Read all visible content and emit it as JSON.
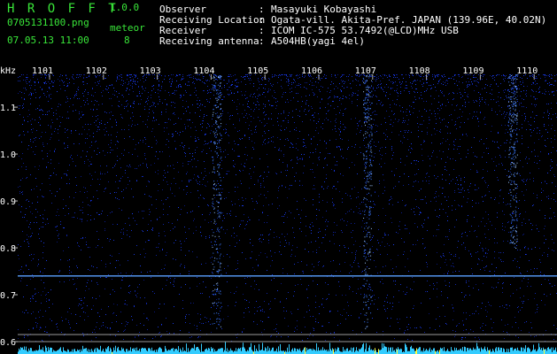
{
  "app": {
    "title": "H R O F F T",
    "version": "1.0.0",
    "filename": "0705131100.png",
    "datetime": "07.05.13 11:00",
    "meteor_label": "meteor",
    "meteor_count": "8"
  },
  "info": [
    {
      "label": "Observer",
      "sep": ":",
      "value": "Masayuki Kobayashi"
    },
    {
      "label": "Receiving Location",
      "sep": ":",
      "value": "Ogata-vill. Akita-Pref. JAPAN (139.96E, 40.02N)"
    },
    {
      "label": "Receiver",
      "sep": ":",
      "value": "ICOM IC-575 53.7492(@LCD)MHz USB"
    },
    {
      "label": "Receiving antenna",
      "sep": ":",
      "value": "A504HB(yagi 4el)"
    }
  ],
  "colors": {
    "title": "#39e639",
    "tick_text": "#ffffff",
    "background": "#000000",
    "noise": "#1a3cff",
    "carrier": "#5aa0ff",
    "histogram": "#33ccff",
    "histogram_hot": "#ffff40"
  },
  "chart_data": {
    "type": "heatmap",
    "ylabel": "kHz",
    "x_ticks": [
      "1101",
      "1102",
      "1103",
      "1104",
      "1105",
      "1106",
      "1107",
      "1108",
      "1109",
      "1110"
    ],
    "y_ticks": [
      "1.1",
      "1.0",
      "0.9",
      "0.8",
      "0.7",
      "0.6"
    ],
    "ylim": [
      0.6,
      1.17
    ],
    "carrier_freq_khz": 0.74,
    "bright_columns_minute": [
      1104.1,
      1106.9,
      1109.6
    ],
    "grid": true
  }
}
